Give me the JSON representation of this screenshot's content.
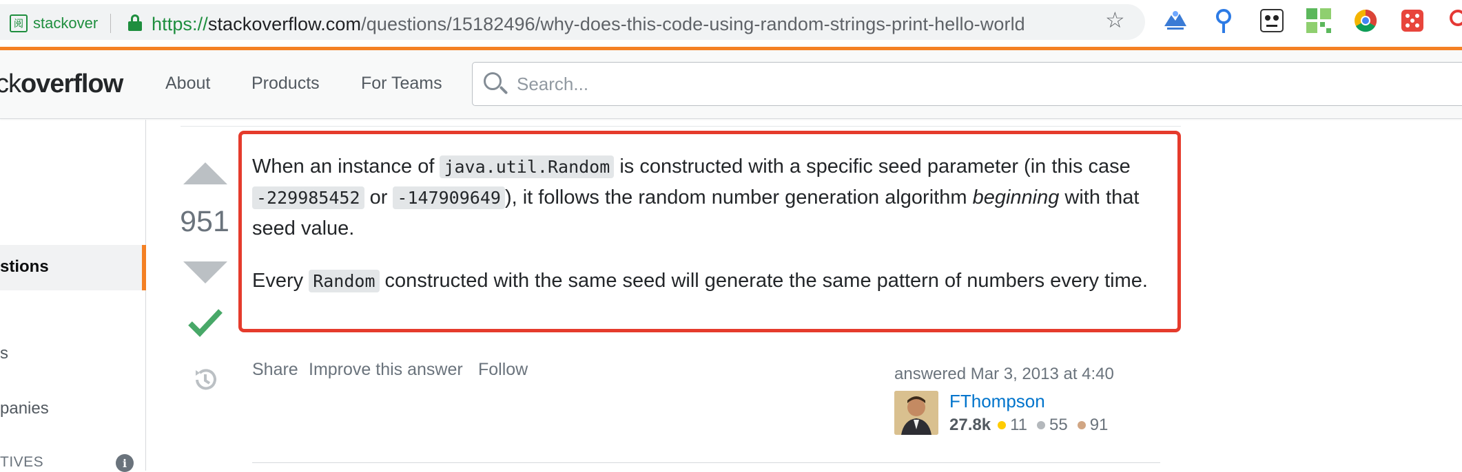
{
  "browser": {
    "site_identity": "stackover",
    "url_scheme": "https://",
    "url_host": "stackoverflow.com",
    "url_path": "/questions/15182496/why-does-this-code-using-random-strings-print-hello-world",
    "extension_icons": [
      "flower-mountain-icon",
      "map-pin-icon",
      "panda-icon",
      "qr-grid-icon",
      "chrome-like-icon",
      "dice-icon"
    ]
  },
  "header": {
    "logo_light": "ck",
    "logo_bold": "overflow",
    "nav": [
      "About",
      "Products",
      "For Teams"
    ],
    "search_placeholder": "Search..."
  },
  "sidebar": {
    "active_item": "stions",
    "items": [
      "s",
      "panies"
    ],
    "section_label": "TIVES"
  },
  "answer": {
    "vote_count": "951",
    "accepted": true,
    "paragraph1": {
      "t1": "When an instance of ",
      "c1": "java.util.Random",
      "t2": " is constructed with a specific seed parameter (in this case ",
      "c2": "-229985452",
      "t3": " or ",
      "c3": "-147909649",
      "t4": "), it follows the random number generation algorithm ",
      "em": "beginning",
      "t5": " with that seed value."
    },
    "paragraph2": {
      "t1": "Every ",
      "c1": "Random",
      "t2": " constructed with the same seed will generate the same pattern of numbers every time."
    },
    "menu": [
      "Share",
      "Improve this answer",
      "Follow"
    ],
    "answered_text": "answered Mar 3, 2013 at 4:40",
    "user": {
      "name": "FThompson",
      "reputation": "27.8k",
      "gold": "11",
      "silver": "55",
      "bronze": "91"
    },
    "colors": {
      "highlight_border": "#e53b2c",
      "accent": "#f48024",
      "accepted_check": "#48a868",
      "gold": "#ffcc01",
      "silver": "#b4b8bc",
      "bronze": "#d1a684"
    }
  }
}
